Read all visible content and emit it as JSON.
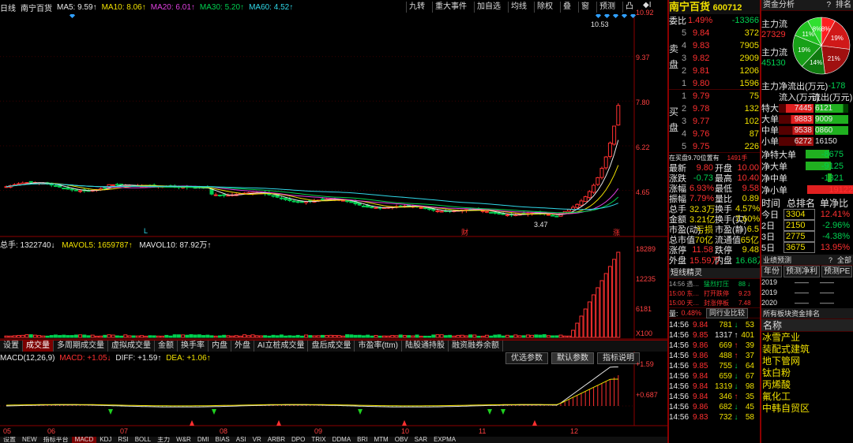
{
  "colors": {
    "up": "#ff3030",
    "down": "#00d050",
    "ma5": "#e8e8e8",
    "ma10": "#f0e000",
    "ma20": "#e040e0",
    "ma30": "#00d050",
    "ma60": "#30d8e8",
    "bg": "#000000",
    "accent": "#8b0000"
  },
  "topbar": {
    "period": "日线",
    "stock": "南宁百货",
    "ma5": "MA5: 9.59↑",
    "ma10": "MA10: 8.06↑",
    "ma20": "MA20: 6.01↑",
    "ma30": "MA30: 5.20↑",
    "ma60": "MA60: 4.52↑",
    "buttons": [
      "九转",
      "重大事件",
      "加自选",
      "均线",
      "除权",
      "叠",
      "窗",
      "预测",
      "凸"
    ],
    "nav_icon": "◆I"
  },
  "price_axis": [
    "10.92",
    "9.37",
    "7.80",
    "6.22",
    "4.65"
  ],
  "price_labels": {
    "high": "10.53",
    "low": "3.47",
    "mark_l": "L",
    "mark_cai": "财",
    "mark_zhang": "涨"
  },
  "volume": {
    "legend_total": "总手: 1322740↓",
    "legend_mavol5": "MAVOL5: 1659787↑",
    "legend_mavol10": "MAVOL10: 87.92万↑",
    "axis": [
      "18289",
      "12235",
      "6181",
      "X100"
    ]
  },
  "tabs": [
    "设置",
    "成交量",
    "多周期成交量",
    "虚拟成交量",
    "金额",
    "换手率",
    "内盘",
    "外盘",
    "AI立桩成交量",
    "盘后成交量",
    "市盈率(ttm)",
    "陆股通持股",
    "融资融券余额"
  ],
  "tab_selected": 1,
  "macd": {
    "label": "MACD(12,26,9)",
    "macd_val": "MACD: +1.05↓",
    "diff_val": "DIFF: +1.59↑",
    "dea_val": "DEA: +1.06↑",
    "axis": [
      "+1.59",
      "+0.687"
    ],
    "buttons": [
      "优选参数",
      "默认参数",
      "指标说明"
    ]
  },
  "dates": [
    "05",
    "06",
    "07",
    "08",
    "09",
    "10",
    "11",
    "12"
  ],
  "bottom_tabs": [
    "设置",
    "NEW",
    "指标平台",
    "MACD",
    "KDJ",
    "RSI",
    "BOLL",
    "主力",
    "W&R",
    "DMI",
    "BIAS",
    "ASI",
    "VR",
    "ARBR",
    "DPO",
    "TRIX",
    "DDMA",
    "BRI",
    "MTM",
    "OBV",
    "SAR",
    "EXPMA"
  ],
  "stock_header": {
    "name": "南宁百货",
    "code": "600712"
  },
  "weibi": {
    "label": "委比",
    "pct": "1.49%",
    "diff": "-13366"
  },
  "sell_orders": [
    {
      "lvl": "5",
      "price": "9.84",
      "vol": "372"
    },
    {
      "lvl": "4",
      "price": "9.83",
      "vol": "7905"
    },
    {
      "lvl": "3",
      "price": "9.82",
      "vol": "2909"
    },
    {
      "lvl": "2",
      "price": "9.81",
      "vol": "1206"
    },
    {
      "lvl": "1",
      "price": "9.80",
      "vol": "1596"
    }
  ],
  "buy_orders": [
    {
      "lvl": "1",
      "price": "9.79",
      "vol": "75"
    },
    {
      "lvl": "2",
      "price": "9.78",
      "vol": "132"
    },
    {
      "lvl": "3",
      "price": "9.77",
      "vol": "102"
    },
    {
      "lvl": "4",
      "price": "9.76",
      "vol": "87"
    },
    {
      "lvl": "5",
      "price": "9.75",
      "vol": "226"
    }
  ],
  "book_side": {
    "sell": "卖盘",
    "buy": "买盘"
  },
  "zaimai": {
    "text": "在买盘9.70位置有",
    "val": "1491手"
  },
  "quote": [
    {
      "k1": "最新",
      "v1": "9.80",
      "k2": "开盘",
      "v2": "10.00"
    },
    {
      "k1": "涨跌",
      "v1": "-0.73",
      "k2": "最高",
      "v2": "10.40"
    },
    {
      "k1": "涨幅",
      "v1": "6.93%",
      "k2": "最低",
      "v2": "9.58"
    },
    {
      "k1": "振幅",
      "v1": "7.79%",
      "k2": "量比",
      "v2": "0.89"
    },
    {
      "k1": "总手",
      "v1": "32.3万",
      "k2": "换手",
      "v2": "4.57%"
    },
    {
      "k1": "金额",
      "v1": "3.21亿",
      "k2": "换手(实)",
      "v2": "7.60%"
    },
    {
      "k1": "市盈(动)",
      "v1": "亏损",
      "k2": "市盈(静)",
      "v2": "6.5"
    },
    {
      "k1": "总市值",
      "v1": "70亿",
      "k2": "流通值",
      "v2": "65亿"
    },
    {
      "k1": "涨停",
      "v1": "11.58",
      "k2": "跌停",
      "v2": "9.48"
    },
    {
      "k1": "外盘",
      "v1": "15.59万",
      "k2": "内盘",
      "v2": "16.68万"
    }
  ],
  "duanxian": {
    "title": "短线精灵",
    "items": [
      {
        "t": "14:56 遇…",
        "e": "猛烈打压",
        "v": "88 ↓"
      },
      {
        "t": "15:00 东…",
        "e": "打开跌停",
        "v": "9.23"
      },
      {
        "t": "15:00 天…",
        "e": "封涨停板",
        "v": "7.48"
      }
    ],
    "bottom_label": "量:",
    "bottom_val": "0.48%",
    "bottom_btn": "同行业比较"
  },
  "ticks": [
    {
      "t": "14:56",
      "p": "9.84",
      "v": "781",
      "d": "↓",
      "n": "53"
    },
    {
      "t": "14:56",
      "p": "9.85",
      "v": "1317",
      "d": "↑",
      "n": "401"
    },
    {
      "t": "14:56",
      "p": "9.86",
      "v": "669",
      "d": "↑",
      "n": "39"
    },
    {
      "t": "14:56",
      "p": "9.86",
      "v": "488",
      "d": "↑",
      "n": "37"
    },
    {
      "t": "14:56",
      "p": "9.85",
      "v": "755",
      "d": "↓",
      "n": "64"
    },
    {
      "t": "14:56",
      "p": "9.84",
      "v": "659",
      "d": "↓",
      "n": "67"
    },
    {
      "t": "14:56",
      "p": "9.84",
      "v": "1319",
      "d": "↓",
      "n": "98"
    },
    {
      "t": "14:56",
      "p": "9.84",
      "v": "346",
      "d": "↑",
      "n": "35"
    },
    {
      "t": "14:56",
      "p": "9.86",
      "v": "682",
      "d": "↓",
      "n": "45"
    },
    {
      "t": "14:56",
      "p": "9.83",
      "v": "732",
      "d": "↓",
      "n": "58"
    }
  ],
  "fund": {
    "title": "资金分析",
    "btn_help": "?",
    "btn_rank": "排名",
    "zl_label": "主力流",
    "zl_in": "27329",
    "zl_out": "45130",
    "pie": [
      {
        "label": "8%",
        "value": 8,
        "color": "#ff2020"
      },
      {
        "label": "19%",
        "value": 19,
        "color": "#d01818"
      },
      {
        "label": "21%",
        "value": 21,
        "color": "#a01010"
      },
      {
        "label": "14%",
        "value": 14,
        "color": "#107a10"
      },
      {
        "label": "19%",
        "value": 19,
        "color": "#18a018"
      },
      {
        "label": "11%",
        "value": 11,
        "color": "#20c020"
      },
      {
        "label": "8%",
        "value": 8,
        "color": "#30e030"
      }
    ],
    "net_label": "主力净流出(万元)",
    "net_val": "-178",
    "flow_hdr_in": "流入(万元)",
    "flow_hdr_out": "流出(万元)",
    "flows": [
      {
        "k": "特大",
        "in": "7445",
        "out": "6121"
      },
      {
        "k": "大单",
        "in": "9883",
        "out": "9009"
      },
      {
        "k": "中单",
        "in": "9538",
        "out": "0860"
      },
      {
        "k": "小单",
        "in": "6272",
        "out": "16150"
      }
    ],
    "nets": [
      {
        "k": "净特大单",
        "v": "-8675",
        "neg": true,
        "frac": 0.45
      },
      {
        "k": "净大单",
        "v": "-9125",
        "neg": true,
        "frac": 0.47
      },
      {
        "k": "净中单",
        "v": "-1321",
        "neg": true,
        "frac": 0.07
      },
      {
        "k": "净小单",
        "v": "19122",
        "neg": false,
        "frac": 1.0
      }
    ],
    "rank_hdr": [
      "时间",
      "总排名",
      "单净比"
    ],
    "ranks": [
      {
        "k": "今日",
        "r": "3304",
        "p": "12.41%"
      },
      {
        "k": "2日",
        "r": "2150",
        "p": "-2.96%"
      },
      {
        "k": "3日",
        "r": "2775",
        "p": "-4.38%"
      },
      {
        "k": "5日",
        "r": "3675",
        "p": "13.95%"
      }
    ]
  },
  "yeji": {
    "title": "业绩预测",
    "btn_help": "?",
    "btn_all": "全部",
    "cols": [
      "年份",
      "预测净利",
      "预测PE"
    ],
    "years": [
      "2019",
      "2019",
      "2020"
    ]
  },
  "sector": {
    "title": "所有板块资金排名",
    "col": "名称",
    "items": [
      "冰雪产业",
      "装配式建筑",
      "地下管网",
      "钛白粉",
      "丙烯酸",
      "氟化工",
      "中韩自贸区"
    ]
  }
}
